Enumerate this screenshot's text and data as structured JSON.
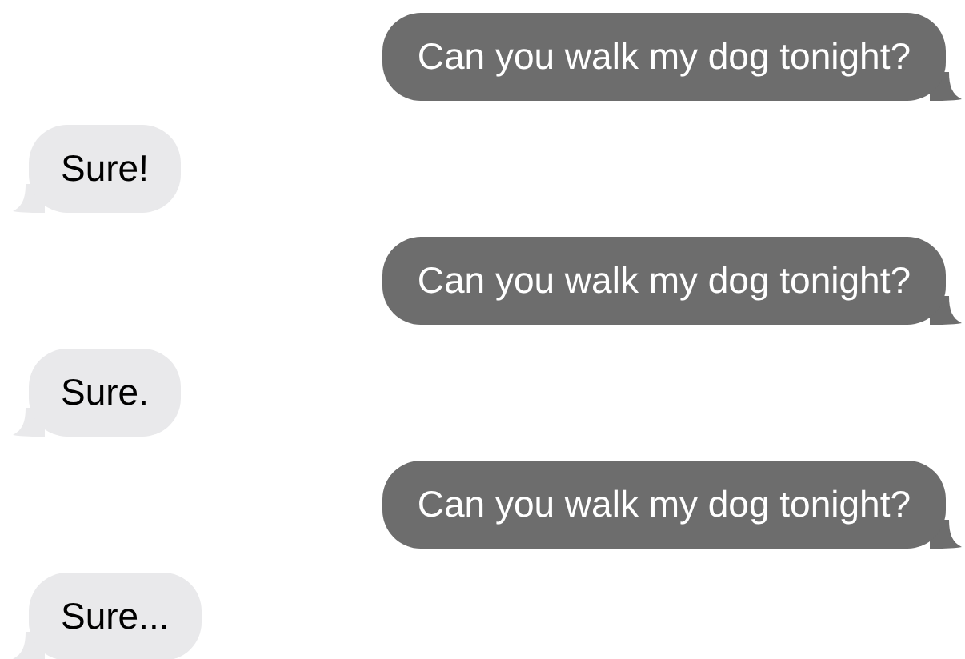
{
  "messages": [
    {
      "kind": "sent",
      "text": "Can you walk my dog tonight?"
    },
    {
      "kind": "received",
      "text": "Sure!"
    },
    {
      "kind": "sent",
      "text": "Can you walk my dog tonight?"
    },
    {
      "kind": "received",
      "text": "Sure."
    },
    {
      "kind": "sent",
      "text": "Can you walk my dog tonight?"
    },
    {
      "kind": "received",
      "text": "Sure..."
    }
  ]
}
